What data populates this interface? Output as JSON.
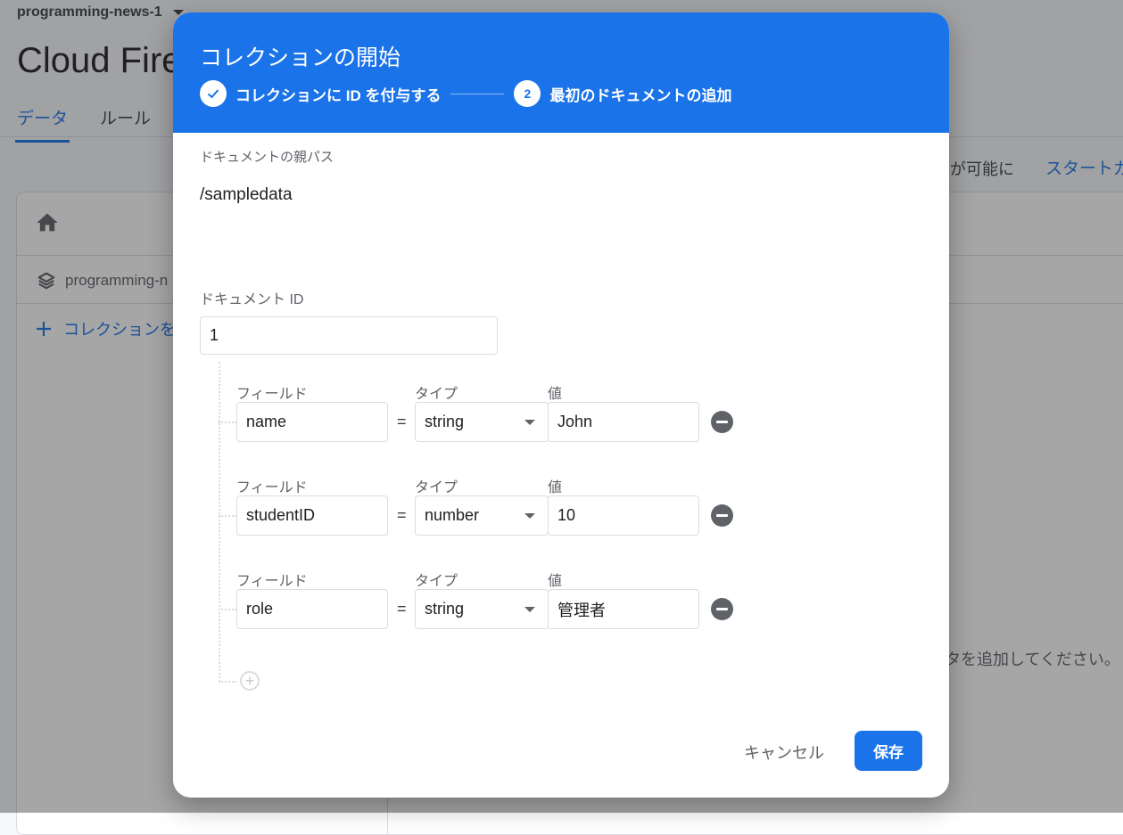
{
  "background": {
    "project_name": "programming-news-1",
    "page_title": "Cloud Fire",
    "tabs": [
      {
        "label": "データ"
      },
      {
        "label": "ルール"
      }
    ],
    "right_note": "が可能に",
    "start_guide": "スタートガ",
    "project_row": "programming-n",
    "add_collection": "コレクションを",
    "empty_hint": "タを追加してください。"
  },
  "dialog": {
    "title": "コレクションの開始",
    "steps": [
      {
        "label": "コレクションに ID を付与する",
        "state": "done"
      },
      {
        "number": "2",
        "label": "最初のドキュメントの追加",
        "state": "active"
      }
    ],
    "parent_path_label": "ドキュメントの親パス",
    "parent_path": "/sampledata",
    "doc_id_label": "ドキュメント ID",
    "doc_id": "1",
    "field_label": "フィールド",
    "type_label": "タイプ",
    "value_label": "値",
    "equals": "=",
    "fields": [
      {
        "name": "name",
        "type": "string",
        "value": "John"
      },
      {
        "name": "studentID",
        "type": "number",
        "value": "10"
      },
      {
        "name": "role",
        "type": "string",
        "value": "管理者"
      }
    ],
    "cancel_label": "キャンセル",
    "save_label": "保存"
  },
  "colors": {
    "accent": "#1a73e8",
    "border": "#dadce0",
    "muted_text": "#5f6368"
  }
}
